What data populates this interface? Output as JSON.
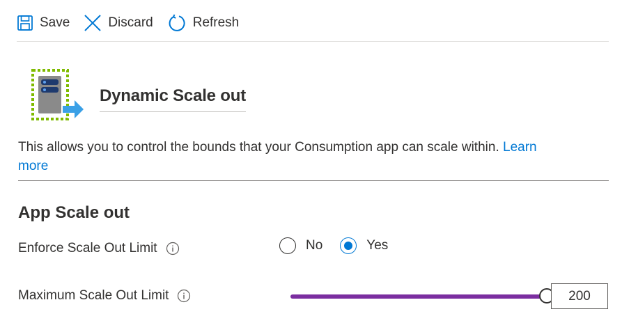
{
  "toolbar": {
    "save_label": "Save",
    "discard_label": "Discard",
    "refresh_label": "Refresh"
  },
  "header": {
    "title": "Dynamic Scale out",
    "icon": "scale-out-server-icon"
  },
  "description": {
    "text": "This allows you to control the bounds that your Consumption app can scale within. ",
    "link_text": "Learn more"
  },
  "section": {
    "title": "App Scale out"
  },
  "fields": {
    "enforce_limit": {
      "label": "Enforce Scale Out Limit",
      "options": [
        "No",
        "Yes"
      ],
      "selected": "Yes"
    },
    "max_limit": {
      "label": "Maximum Scale Out Limit",
      "value": "200",
      "slider_fraction": 1.0
    }
  },
  "colors": {
    "accent": "#0078d4",
    "slider_fill": "#7b2ea0",
    "text": "#323130"
  }
}
